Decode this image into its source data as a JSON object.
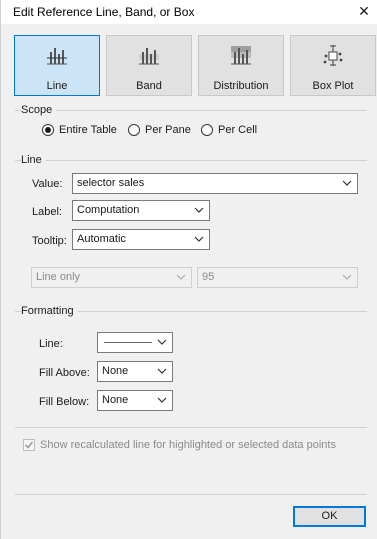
{
  "window": {
    "title": "Edit Reference Line, Band, or Box",
    "close_icon": "close-icon"
  },
  "types": [
    {
      "label": "Line",
      "icon": "line-chart-icon",
      "selected": true
    },
    {
      "label": "Band",
      "icon": "band-chart-icon",
      "selected": false
    },
    {
      "label": "Distribution",
      "icon": "distribution-chart-icon",
      "selected": false
    },
    {
      "label": "Box Plot",
      "icon": "box-plot-icon",
      "selected": false
    }
  ],
  "scope": {
    "label": "Scope",
    "options": [
      {
        "label": "Entire Table",
        "selected": true
      },
      {
        "label": "Per Pane",
        "selected": false
      },
      {
        "label": "Per Cell",
        "selected": false
      }
    ]
  },
  "line": {
    "label": "Line",
    "value_label": "Value:",
    "value": "selector sales",
    "label_label": "Label:",
    "label_value": "Computation",
    "tooltip_label": "Tooltip:",
    "tooltip_value": "Automatic",
    "confidence_left": "Line only",
    "confidence_right": "95"
  },
  "formatting": {
    "label": "Formatting",
    "line_label": "Line:",
    "fill_above_label": "Fill Above:",
    "fill_above_value": "None",
    "fill_below_label": "Fill Below:",
    "fill_below_value": "None"
  },
  "recalc": {
    "label": "Show recalculated line for highlighted or selected data points",
    "checked": true,
    "disabled": true
  },
  "ok_label": "OK",
  "colors": {
    "selected_bg": "#cce4f7",
    "accent": "#0078d7",
    "dialog_bg": "#f0f0f0"
  }
}
